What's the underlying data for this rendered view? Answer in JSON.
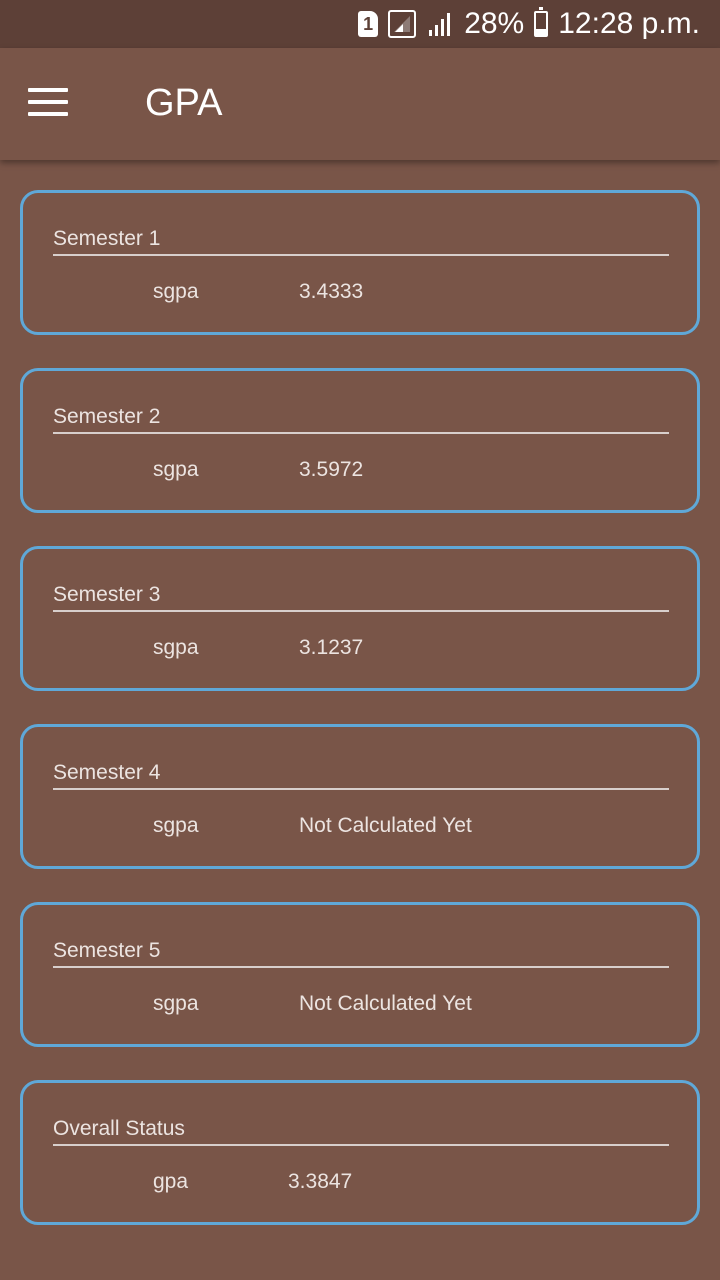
{
  "status_bar": {
    "sim_label": "1",
    "battery_percent": "28%",
    "battery_level": 0.28,
    "time": "12:28 p.m.",
    "icons": [
      "sim-icon",
      "signal-icon",
      "signal-icon",
      "battery-icon"
    ]
  },
  "app_bar": {
    "title": "GPA",
    "menu_icon": "hamburger-menu-icon"
  },
  "semesters": [
    {
      "title": "Semester 1",
      "label": "sgpa",
      "value": "3.4333"
    },
    {
      "title": "Semester 2",
      "label": "sgpa",
      "value": "3.5972"
    },
    {
      "title": "Semester 3",
      "label": "sgpa",
      "value": "3.1237"
    },
    {
      "title": "Semester 4",
      "label": "sgpa",
      "value": "Not Calculated Yet"
    },
    {
      "title": "Semester 5",
      "label": "sgpa",
      "value": "Not Calculated Yet"
    }
  ],
  "overall": {
    "title": "Overall Status",
    "label": "gpa",
    "value": "3.3847"
  },
  "colors": {
    "background": "#795548",
    "status_bar": "#5d4037",
    "card_border": "#5fa8d8"
  }
}
